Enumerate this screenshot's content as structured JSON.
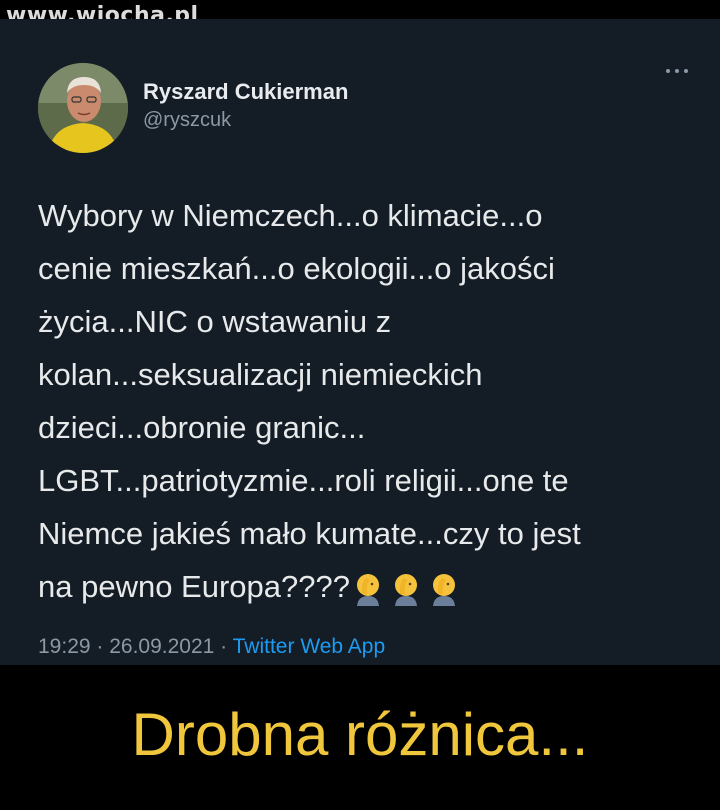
{
  "watermark": "www.wiocha.pl",
  "tweet": {
    "author_name": "Ryszard Cukierman",
    "author_handle": "@ryszcuk",
    "text": "Wybory w Niemczech...o klimacie...o\ncenie mieszkań...o ekologii...o jakości\nżycia...NIC o wstawaniu z\nkolan...seksualizacji niemieckich\ndzieci...obronie granic...\nLGBT...patriotyzmie...roli religii...one te\nNiemce jakieś mało kumate...czy to jest\nna pewno Europa????",
    "emojis": [
      "face-palm-emoji",
      "face-palm-emoji",
      "face-palm-emoji"
    ],
    "time": "19:29",
    "date": "26.09.2021",
    "separator": " · ",
    "source": "Twitter Web App"
  },
  "caption": "Drobna różnica...",
  "colors": {
    "card_bg": "#141d26",
    "caption": "#f0c73c",
    "link": "#1d9bf0",
    "muted": "#8b98a5"
  },
  "icons": {
    "more": "more-horizontal-icon"
  }
}
